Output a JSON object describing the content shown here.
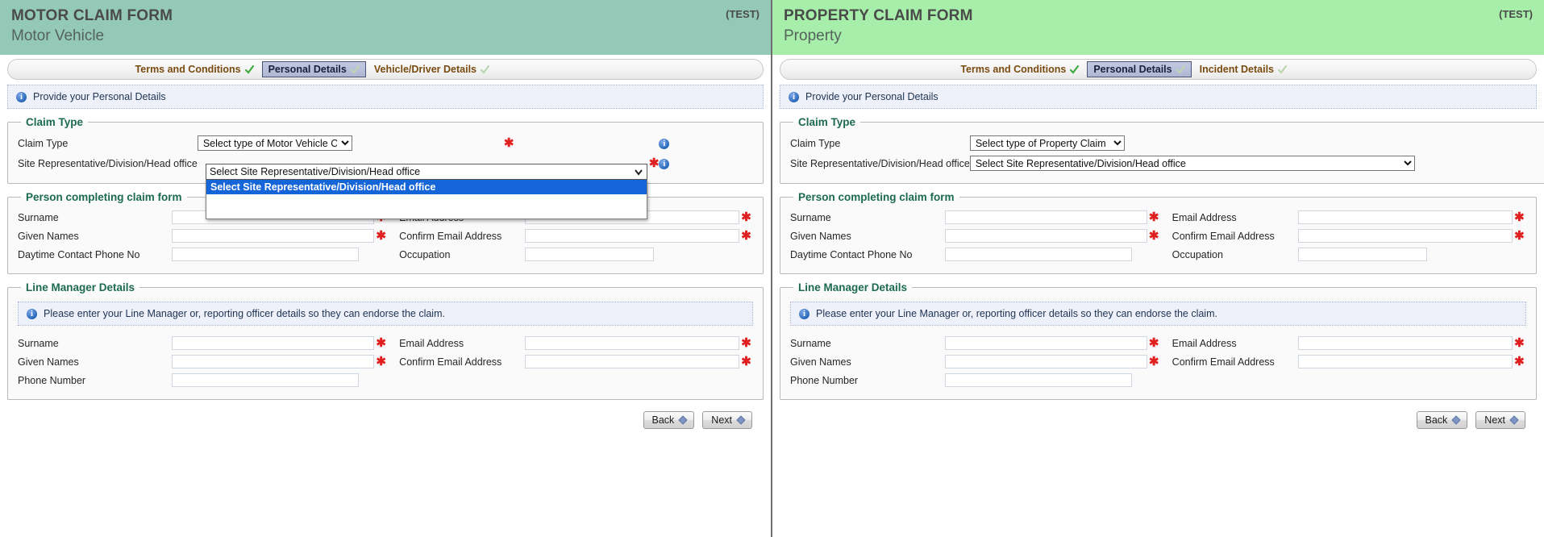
{
  "panels": [
    {
      "key": "motor",
      "header": {
        "title": "MOTOR CLAIM FORM",
        "subtitle": "Motor Vehicle",
        "env_badge": "(TEST)",
        "bg": "#93c9b6"
      },
      "tabs": [
        {
          "label": "Terms and Conditions",
          "state": "complete",
          "active": false
        },
        {
          "label": "Personal Details",
          "state": "current",
          "active": true
        },
        {
          "label": "Vehicle/Driver Details",
          "state": "pending",
          "active": false
        }
      ],
      "info_banner": "Provide your Personal Details",
      "claim_type": {
        "legend": "Claim Type",
        "claim_type_label": "Claim Type",
        "claim_type_value": "Select type of Motor Vehicle Claim",
        "claim_type_options": [
          "Select type of Motor Vehicle Claim"
        ],
        "site_rep_label": "Site Representative/Division/Head office",
        "site_rep_value": "Select Site Representative/Division/Head office",
        "site_rep_options": [
          "Select Site Representative/Division/Head office"
        ],
        "site_rep_expanded": true
      },
      "person_section": {
        "legend": "Person completing claim form",
        "rows": [
          {
            "left_label": "Surname",
            "left_required": true,
            "right_label": "Email Address",
            "right_required": true
          },
          {
            "left_label": "Given Names",
            "left_required": true,
            "right_label": "Confirm Email Address",
            "right_required": true
          },
          {
            "left_label": "Daytime Contact Phone No",
            "left_required": false,
            "right_label": "Occupation",
            "right_required": false
          }
        ]
      },
      "manager_section": {
        "legend": "Line Manager Details",
        "notice": "Please enter your Line Manager or, reporting officer details so they can endorse the claim.",
        "rows": [
          {
            "left_label": "Surname",
            "left_required": true,
            "right_label": "Email Address",
            "right_required": true
          },
          {
            "left_label": "Given Names",
            "left_required": true,
            "right_label": "Confirm Email Address",
            "right_required": true
          },
          {
            "left_label": "Phone Number",
            "left_required": false,
            "right_label": "",
            "right_required": false
          }
        ]
      },
      "buttons": {
        "back": "Back",
        "next": "Next"
      }
    },
    {
      "key": "property",
      "header": {
        "title": "PROPERTY CLAIM FORM",
        "subtitle": "Property",
        "env_badge": "(TEST)",
        "bg": "#a6eea9"
      },
      "tabs": [
        {
          "label": "Terms and Conditions",
          "state": "complete",
          "active": false
        },
        {
          "label": "Personal Details",
          "state": "current",
          "active": true
        },
        {
          "label": "Incident Details",
          "state": "pending",
          "active": false
        }
      ],
      "info_banner": "Provide your Personal Details",
      "claim_type": {
        "legend": "Claim Type",
        "claim_type_label": "Claim Type",
        "claim_type_value": "Select type of Property Claim",
        "claim_type_options": [
          "Select type of Property Claim"
        ],
        "site_rep_label": "Site Representative/Division/Head office",
        "site_rep_value": "Select Site Representative/Division/Head office",
        "site_rep_options": [
          "Select Site Representative/Division/Head office"
        ],
        "site_rep_expanded": false
      },
      "person_section": {
        "legend": "Person completing claim form",
        "rows": [
          {
            "left_label": "Surname",
            "left_required": true,
            "right_label": "Email Address",
            "right_required": true
          },
          {
            "left_label": "Given Names",
            "left_required": true,
            "right_label": "Confirm Email Address",
            "right_required": true
          },
          {
            "left_label": "Daytime Contact Phone No",
            "left_required": false,
            "right_label": "Occupation",
            "right_required": false
          }
        ]
      },
      "manager_section": {
        "legend": "Line Manager Details",
        "notice": "Please enter your Line Manager or, reporting officer details so they can endorse the claim.",
        "rows": [
          {
            "left_label": "Surname",
            "left_required": true,
            "right_label": "Email Address",
            "right_required": true
          },
          {
            "left_label": "Given Names",
            "left_required": true,
            "right_label": "Confirm Email Address",
            "right_required": true
          },
          {
            "left_label": "Phone Number",
            "left_required": false,
            "right_label": "",
            "right_required": false
          }
        ]
      },
      "buttons": {
        "back": "Back",
        "next": "Next"
      }
    }
  ],
  "glyphs": {
    "required_mark": "✱",
    "info_mark": "i",
    "tick_complete_color": "#3faa3f",
    "tick_pending_color": "#b9d6b0"
  }
}
